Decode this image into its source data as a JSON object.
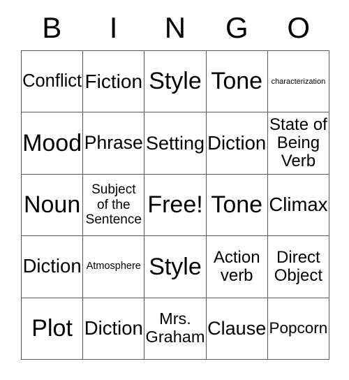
{
  "card": {
    "title": "BINGO",
    "header_letters": [
      "B",
      "I",
      "N",
      "G",
      "O"
    ],
    "border_color": "#595959",
    "background_color": "#ffffff",
    "text_color": "#000000",
    "grid_size": "5x5",
    "free_space": "Free!",
    "rows": [
      [
        {
          "text": "Conflict",
          "size": "xl"
        },
        {
          "text": "Fiction",
          "size": "xl"
        },
        {
          "text": "Style",
          "size": "xxl"
        },
        {
          "text": "Tone",
          "size": "xxl"
        },
        {
          "text": "characterization",
          "size": "xs"
        }
      ],
      [
        {
          "text": "Mood",
          "size": "xxl"
        },
        {
          "text": "Phrase",
          "size": "xl"
        },
        {
          "text": "Setting",
          "size": "xl"
        },
        {
          "text": "Diction",
          "size": "xl"
        },
        {
          "text": "State of\nBeing\nVerb",
          "size": "lg"
        }
      ],
      [
        {
          "text": "Noun",
          "size": "xxl"
        },
        {
          "text": "Subject\nof the\nSentence",
          "size": "md"
        },
        {
          "text": "Free!",
          "size": "xxl"
        },
        {
          "text": "Tone",
          "size": "xxl"
        },
        {
          "text": "Climax",
          "size": "xl"
        }
      ],
      [
        {
          "text": "Diction",
          "size": "xl"
        },
        {
          "text": "Atmosphere",
          "size": "sm"
        },
        {
          "text": "Style",
          "size": "xxl"
        },
        {
          "text": "Action\nverb",
          "size": "lg"
        },
        {
          "text": "Direct\nObject",
          "size": "lg"
        }
      ],
      [
        {
          "text": "Plot",
          "size": "xxl"
        },
        {
          "text": "Diction",
          "size": "xl"
        },
        {
          "text": "Mrs.\nGraham",
          "size": "lg"
        },
        {
          "text": "Clause",
          "size": "xl"
        },
        {
          "text": "Popcorn",
          "size": "xl"
        }
      ]
    ]
  }
}
